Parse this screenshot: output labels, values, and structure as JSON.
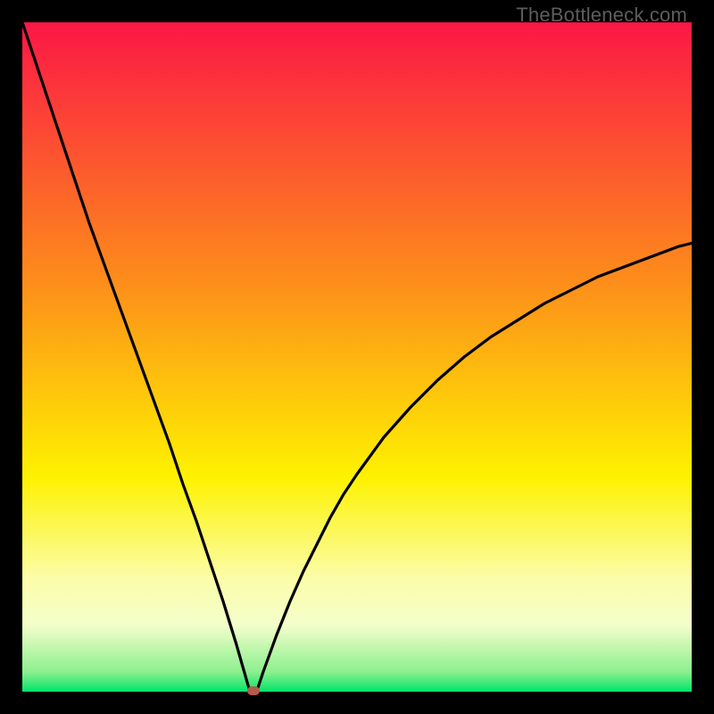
{
  "watermark": "TheBottleneck.com",
  "colors": {
    "gradient_top": "#fb1746",
    "gradient_mid1": "#fd8b1b",
    "gradient_mid2": "#fef200",
    "gradient_mid3": "#fbfda8",
    "gradient_bottom": "#00e46a",
    "curve": "#000000",
    "marker": "#b55a4b",
    "frame": "#000000"
  },
  "chart_data": {
    "type": "line",
    "title": "",
    "xlabel": "",
    "ylabel": "",
    "xlim": [
      0,
      100
    ],
    "ylim": [
      0,
      100
    ],
    "minimum_x": 34,
    "x": [
      0,
      2,
      4,
      6,
      8,
      10,
      12,
      14,
      16,
      18,
      20,
      22,
      24,
      26,
      28,
      30,
      32,
      33,
      34,
      35,
      36,
      38,
      40,
      42,
      44,
      46,
      48,
      50,
      54,
      58,
      62,
      66,
      70,
      74,
      78,
      82,
      86,
      90,
      94,
      98,
      100
    ],
    "values": [
      100,
      94,
      88,
      82,
      76,
      70,
      64.5,
      59,
      53.5,
      48,
      42.5,
      37,
      31,
      25.5,
      19.5,
      13.5,
      7,
      3.5,
      0,
      0,
      3,
      8.5,
      13.5,
      18,
      22,
      26,
      29.5,
      32.5,
      38,
      42.5,
      46.5,
      50,
      53,
      55.5,
      58,
      60,
      62,
      63.5,
      65,
      66.5,
      67
    ],
    "marker": {
      "x": 34.5,
      "y": 0
    }
  }
}
